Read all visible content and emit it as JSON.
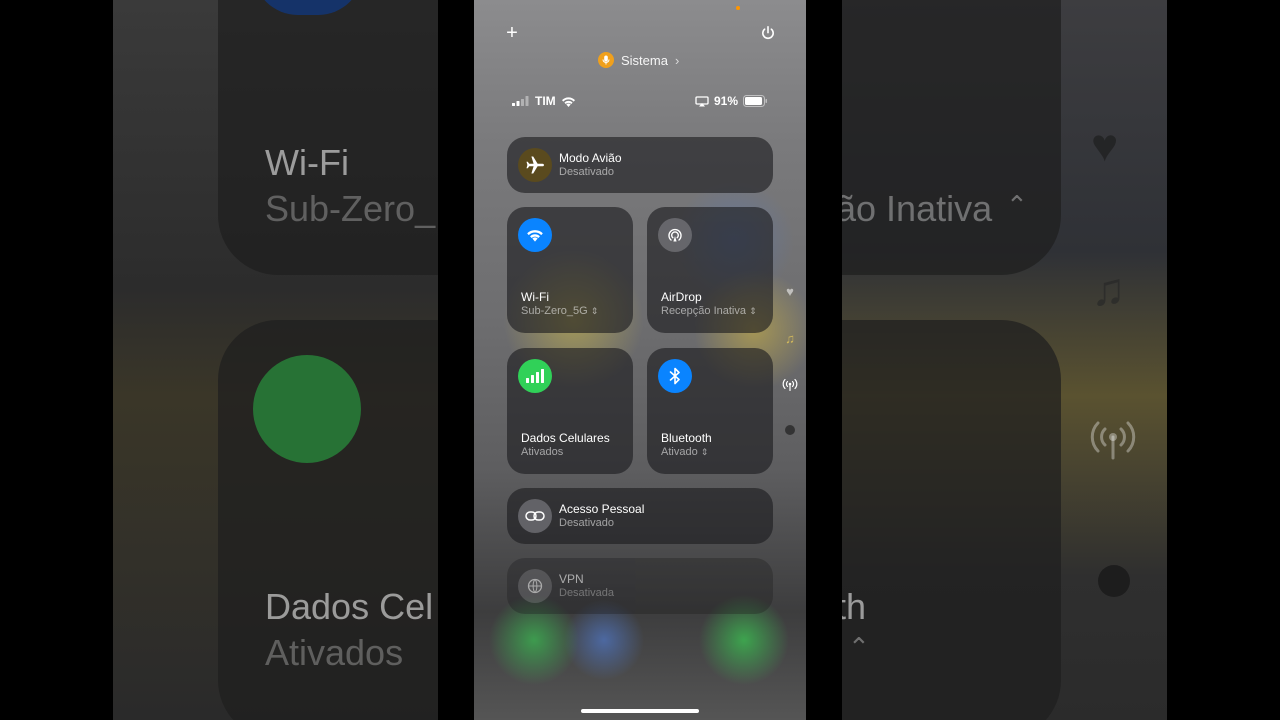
{
  "top": {
    "add_glyph": "+",
    "power_icon": "power-icon",
    "focus_label": "Sistema",
    "focus_color": "#f0a01c"
  },
  "status": {
    "carrier": "TIM",
    "battery": "91%"
  },
  "tiles": {
    "airplane": {
      "title": "Modo Avião",
      "subtitle": "Desativado"
    },
    "wifi": {
      "title": "Wi-Fi",
      "subtitle": "Sub-Zero_5G"
    },
    "airdrop": {
      "title": "AirDrop",
      "subtitle": "Recepção Inativa"
    },
    "cellular": {
      "title": "Dados Celulares",
      "subtitle": "Ativados"
    },
    "bluetooth": {
      "title": "Bluetooth",
      "subtitle": "Ativado"
    },
    "hotspot": {
      "title": "Acesso Pessoal",
      "subtitle": "Desativado"
    },
    "vpn": {
      "title": "VPN",
      "subtitle": "Desativada"
    }
  },
  "background": {
    "left_title_1": "Wi-Fi",
    "left_sub_1": "Sub-Zero_",
    "left_title_2": "Dados Cel",
    "left_sub_2": "Ativados",
    "right_sub_1": "ão Inativa",
    "right_title_2": "th"
  },
  "colors": {
    "wifi": "#0a84ff",
    "bluetooth": "#0a84ff",
    "cellular": "#30d158",
    "airplane_bg": "#5a4a1e"
  }
}
